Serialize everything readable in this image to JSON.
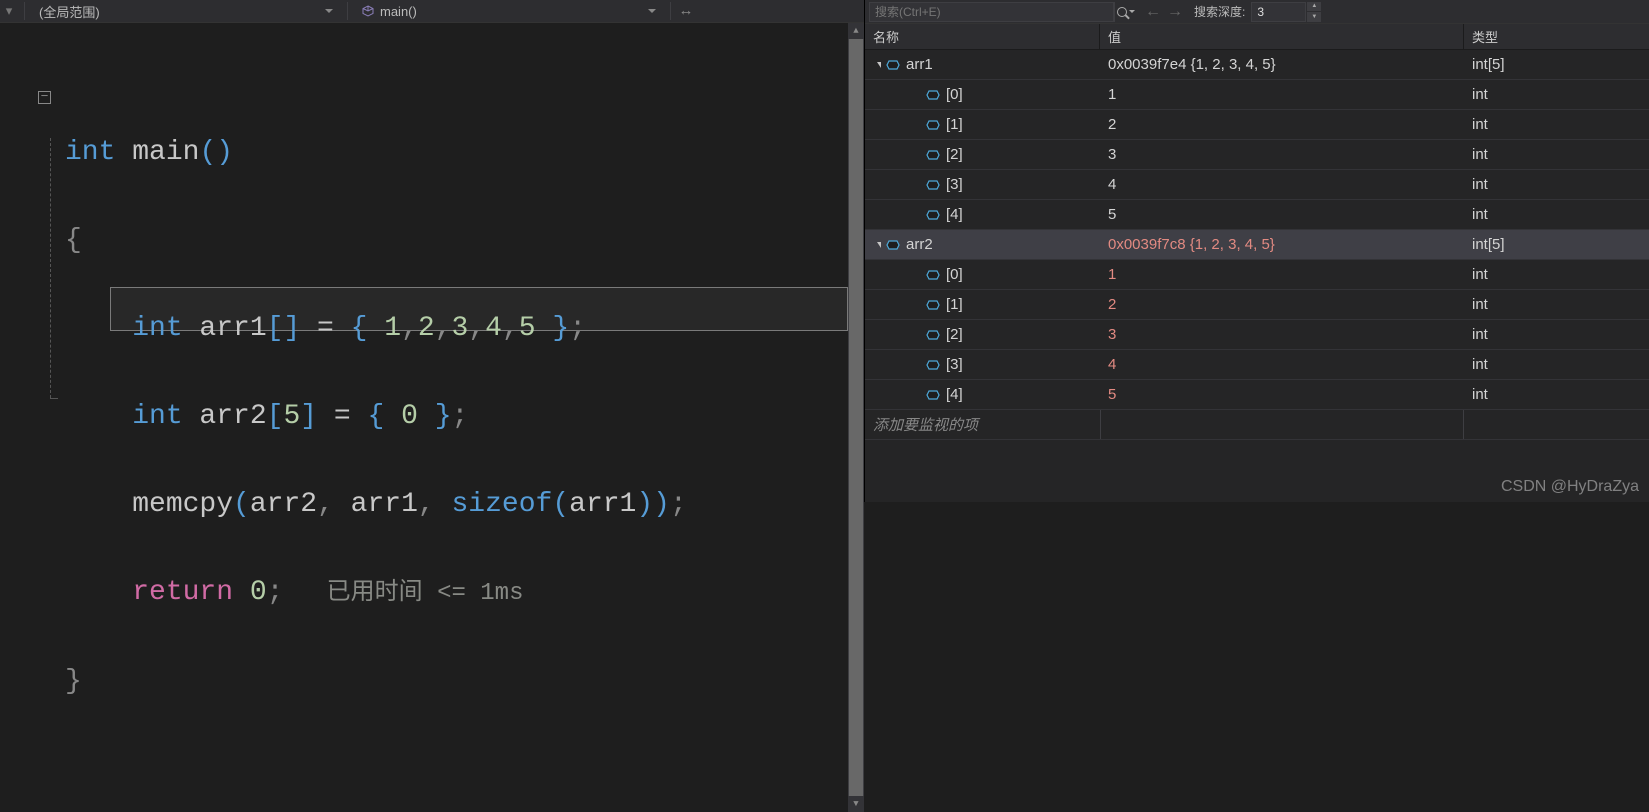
{
  "toolbar": {
    "scope_label": "(全局范围)",
    "func_label": "main()"
  },
  "code": {
    "line1": [
      "int",
      " main",
      "(",
      ")"
    ],
    "line2": "{",
    "line3_a": "    int ",
    "line3_b": "arr1",
    "line3_c": "[]",
    "line3_d": " = ",
    "line3_e": "{ ",
    "line3_f": "1",
    "line3_g": ",",
    "line3_h": "2",
    "line3_i": ",",
    "line3_j": "3",
    "line3_k": ",",
    "line3_l": "4",
    "line3_m": ",",
    "line3_n": "5",
    "line3_o": " }",
    "line3_p": ";",
    "line4_a": "    int ",
    "line4_b": "arr2",
    "line4_c": "[",
    "line4_d": "5",
    "line4_e": "]",
    "line4_f": " = ",
    "line4_g": "{ ",
    "line4_h": "0",
    "line4_i": " }",
    "line4_j": ";",
    "line5_a": "    memcpy",
    "line5_b": "(",
    "line5_c": "arr2",
    "line5_d": ", ",
    "line5_e": "arr1",
    "line5_f": ", ",
    "line5_g": "sizeof",
    "line5_h": "(",
    "line5_i": "arr1",
    "line5_j": "))",
    "line5_k": ";",
    "line6_a": "    return ",
    "line6_b": "0",
    "line6_c": ";",
    "line6_hint": "   已用时间 <= 1ms",
    "line7": "}"
  },
  "watch": {
    "search_placeholder": "搜索(Ctrl+E)",
    "depth_label": "搜索深度:",
    "depth_value": "3",
    "header": {
      "name": "名称",
      "value": "值",
      "type": "类型"
    },
    "rows": [
      {
        "indent": 0,
        "name": "arr1",
        "value": "0x0039f7e4 {1, 2, 3, 4, 5}",
        "type": "int[5]",
        "expanded": true,
        "changed": false,
        "selected": false
      },
      {
        "indent": 1,
        "name": "[0]",
        "value": "1",
        "type": "int",
        "changed": false
      },
      {
        "indent": 1,
        "name": "[1]",
        "value": "2",
        "type": "int",
        "changed": false
      },
      {
        "indent": 1,
        "name": "[2]",
        "value": "3",
        "type": "int",
        "changed": false
      },
      {
        "indent": 1,
        "name": "[3]",
        "value": "4",
        "type": "int",
        "changed": false
      },
      {
        "indent": 1,
        "name": "[4]",
        "value": "5",
        "type": "int",
        "changed": false
      },
      {
        "indent": 0,
        "name": "arr2",
        "value": "0x0039f7c8 {1, 2, 3, 4, 5}",
        "type": "int[5]",
        "expanded": true,
        "changed": true,
        "selected": true
      },
      {
        "indent": 1,
        "name": "[0]",
        "value": "1",
        "type": "int",
        "changed": true
      },
      {
        "indent": 1,
        "name": "[1]",
        "value": "2",
        "type": "int",
        "changed": true
      },
      {
        "indent": 1,
        "name": "[2]",
        "value": "3",
        "type": "int",
        "changed": true
      },
      {
        "indent": 1,
        "name": "[3]",
        "value": "4",
        "type": "int",
        "changed": true
      },
      {
        "indent": 1,
        "name": "[4]",
        "value": "5",
        "type": "int",
        "changed": true
      }
    ],
    "add_item": "添加要监视的项"
  },
  "watermark": "CSDN @HyDraZya"
}
